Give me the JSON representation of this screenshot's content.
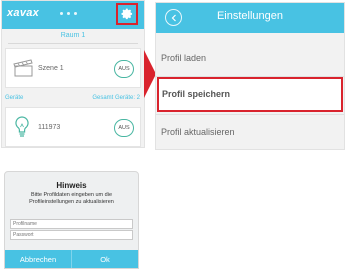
{
  "left": {
    "brand": "xavax",
    "room": "Raum 1",
    "scene_label": "Szene 1",
    "scene_toggle": "AUS",
    "devices_label": "Geräte",
    "devices_total": "Gesamt Geräte: 2",
    "device_name": "111973",
    "device_toggle": "AUS"
  },
  "settings": {
    "title": "Einstellungen",
    "items": [
      {
        "label": "Profil laden"
      },
      {
        "label": "Profil speichern"
      },
      {
        "label": "Profil aktualisieren"
      }
    ]
  },
  "dialog": {
    "title": "Hinweis",
    "message": "Bitte Profildaten eingeben um die Profileinstellungen zu aktualisieren",
    "name_placeholder": "Profilname",
    "password_placeholder": "Passwort",
    "cancel": "Abbrechen",
    "ok": "Ok"
  },
  "colors": {
    "accent": "#48c2e3",
    "highlight": "#d9232d",
    "toggle_border": "#49b6a2"
  },
  "icons": [
    "gear-icon",
    "back-chevron-icon",
    "clapperboard-icon",
    "lightbulb-icon",
    "arrow-right-icon"
  ]
}
